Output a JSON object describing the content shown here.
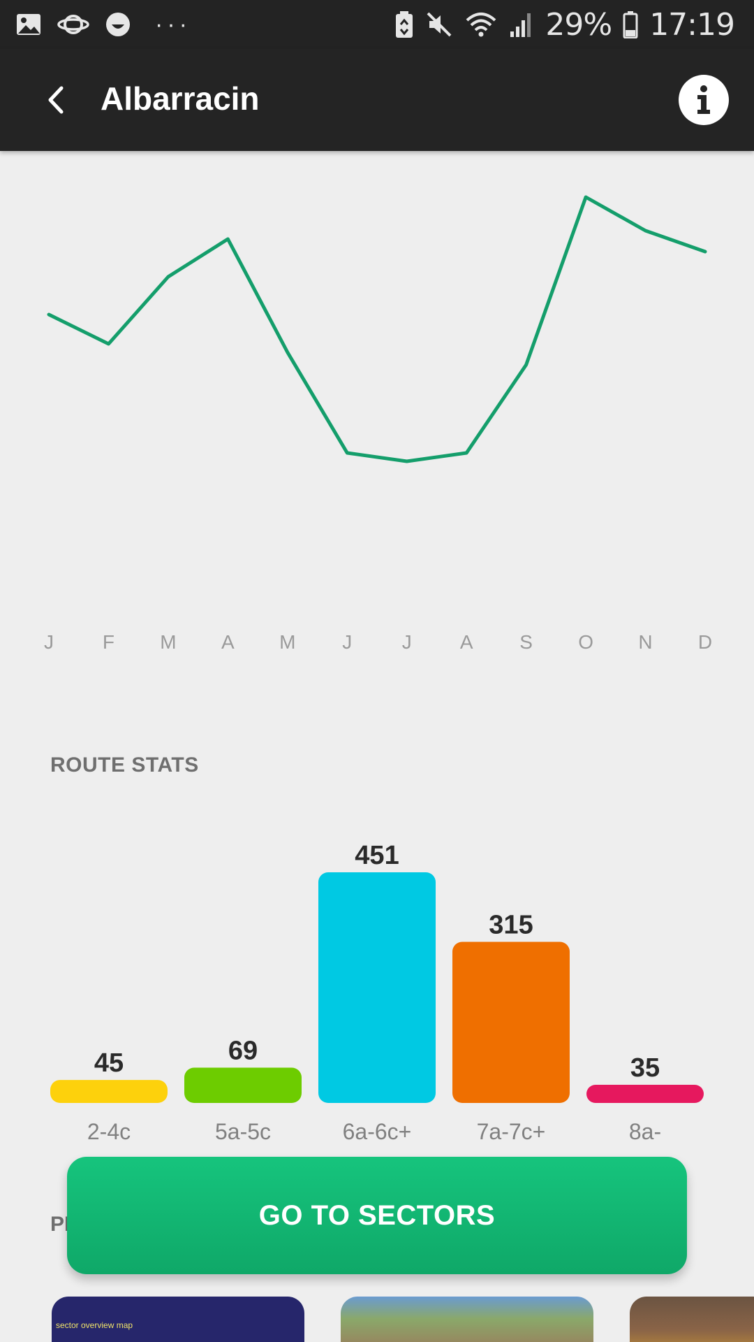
{
  "status_bar": {
    "battery": "29%",
    "time": "17:19",
    "icons": [
      "image-icon",
      "planet-icon",
      "smiley-icon",
      "more-icon",
      "battery-saver-icon",
      "mute-icon",
      "wifi-icon",
      "signal-icon",
      "battery-icon"
    ]
  },
  "app_bar": {
    "title": "Albarracin",
    "back_icon": "chevron-left-icon",
    "info_icon": "info-icon"
  },
  "chart_data": [
    {
      "type": "line",
      "title": "",
      "xlabel": "",
      "ylabel": "",
      "x": [
        "J",
        "F",
        "M",
        "A",
        "M",
        "J",
        "J",
        "A",
        "S",
        "O",
        "N",
        "D"
      ],
      "values": [
        61,
        54,
        70,
        79,
        52,
        28,
        26,
        28,
        49,
        89,
        81,
        76
      ],
      "ylim": [
        0,
        100
      ],
      "color": "#149e6b",
      "grid": false
    },
    {
      "type": "bar",
      "title": "",
      "categories": [
        "2-4c",
        "5a-5c",
        "6a-6c+",
        "7a-7c+",
        "8a-"
      ],
      "values": [
        45,
        69,
        451,
        315,
        35
      ],
      "colors": [
        "#fdd10c",
        "#6dcc00",
        "#00c9e3",
        "#ef6f00",
        "#e6185e"
      ],
      "ylim": [
        0,
        451
      ],
      "grid": false
    }
  ],
  "route_stats": {
    "title": "ROUTE STATS"
  },
  "photos": {
    "title_partial": "PH",
    "thumb_label": "sector overview map"
  },
  "cta": {
    "label": "GO TO SECTORS"
  },
  "colors": {
    "status_bar": "#232323",
    "app_bar": "#242424",
    "background": "#eeeeee",
    "accent_green": "#12b774"
  }
}
